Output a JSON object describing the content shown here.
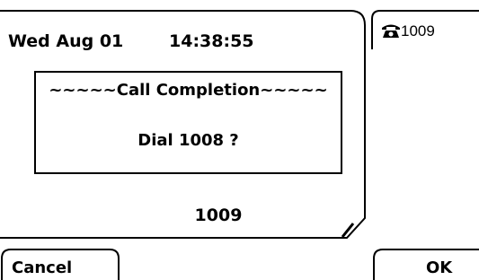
{
  "status_bar": {
    "date": "Wed Aug 01",
    "time": "14:38:55"
  },
  "dialog": {
    "title": "~~~~~Call Completion~~~~~",
    "message": "Dial 1008 ?"
  },
  "extension": "1009",
  "line_key": {
    "icon": "phone-icon",
    "label": "1009"
  },
  "softkeys": {
    "left": "Cancel",
    "right": "OK"
  }
}
